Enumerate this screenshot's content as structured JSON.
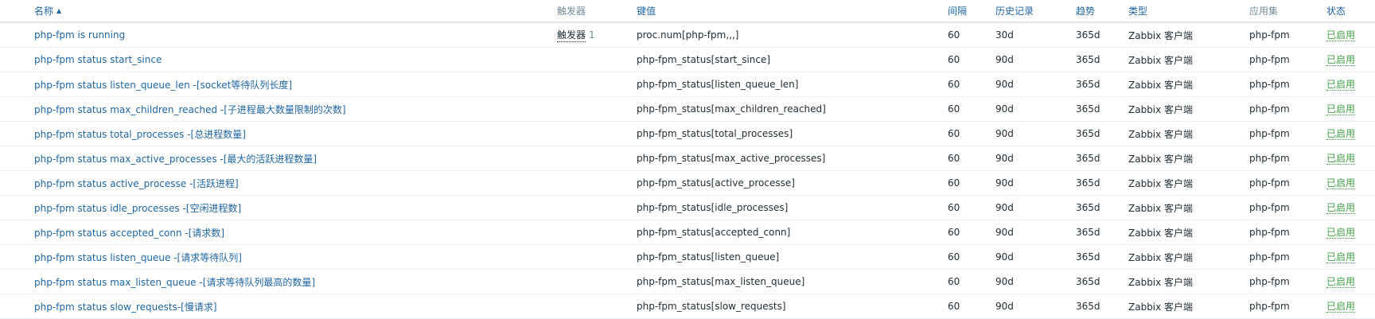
{
  "header": {
    "name": "名称",
    "sort_indicator": "▲",
    "triggers": "触发器",
    "key": "键值",
    "interval": "间隔",
    "history": "历史记录",
    "trends": "趋势",
    "type": "类型",
    "applications": "应用集",
    "status": "状态"
  },
  "colors": {
    "link": "#1f65a0",
    "muted_header": "#768d99",
    "enabled": "#429e47",
    "row_border": "#ebeef0"
  },
  "items": [
    {
      "name": "php-fpm is running",
      "trigger_label": "触发器",
      "trigger_count": "1",
      "key": "proc.num[php-fpm,,,]",
      "interval": "60",
      "history": "30d",
      "trends": "365d",
      "type": "Zabbix 客户端",
      "application": "php-fpm",
      "status": "已启用"
    },
    {
      "name": "php-fpm status start_since",
      "key": "php-fpm_status[start_since]",
      "interval": "60",
      "history": "90d",
      "trends": "365d",
      "type": "Zabbix 客户端",
      "application": "php-fpm",
      "status": "已启用"
    },
    {
      "name": "php-fpm status listen_queue_len -[socket等待队列长度]",
      "key": "php-fpm_status[listen_queue_len]",
      "interval": "60",
      "history": "90d",
      "trends": "365d",
      "type": "Zabbix 客户端",
      "application": "php-fpm",
      "status": "已启用"
    },
    {
      "name": "php-fpm status max_children_reached -[子进程最大数量限制的次数]",
      "key": "php-fpm_status[max_children_reached]",
      "interval": "60",
      "history": "90d",
      "trends": "365d",
      "type": "Zabbix 客户端",
      "application": "php-fpm",
      "status": "已启用"
    },
    {
      "name": "php-fpm status total_processes -[总进程数量]",
      "key": "php-fpm_status[total_processes]",
      "interval": "60",
      "history": "90d",
      "trends": "365d",
      "type": "Zabbix 客户端",
      "application": "php-fpm",
      "status": "已启用"
    },
    {
      "name": "php-fpm status max_active_processes -[最大的活跃进程数量]",
      "key": "php-fpm_status[max_active_processes]",
      "interval": "60",
      "history": "90d",
      "trends": "365d",
      "type": "Zabbix 客户端",
      "application": "php-fpm",
      "status": "已启用"
    },
    {
      "name": "php-fpm status active_processe -[活跃进程]",
      "key": "php-fpm_status[active_processe]",
      "interval": "60",
      "history": "90d",
      "trends": "365d",
      "type": "Zabbix 客户端",
      "application": "php-fpm",
      "status": "已启用"
    },
    {
      "name": "php-fpm status idle_processes -[空闲进程数]",
      "key": "php-fpm_status[idle_processes]",
      "interval": "60",
      "history": "90d",
      "trends": "365d",
      "type": "Zabbix 客户端",
      "application": "php-fpm",
      "status": "已启用"
    },
    {
      "name": "php-fpm status accepted_conn -[请求数]",
      "key": "php-fpm_status[accepted_conn]",
      "interval": "60",
      "history": "90d",
      "trends": "365d",
      "type": "Zabbix 客户端",
      "application": "php-fpm",
      "status": "已启用"
    },
    {
      "name": "php-fpm status listen_queue -[请求等待队列]",
      "key": "php-fpm_status[listen_queue]",
      "interval": "60",
      "history": "90d",
      "trends": "365d",
      "type": "Zabbix 客户端",
      "application": "php-fpm",
      "status": "已启用"
    },
    {
      "name": "php-fpm status max_listen_queue -[请求等待队列最高的数量]",
      "key": "php-fpm_status[max_listen_queue]",
      "interval": "60",
      "history": "90d",
      "trends": "365d",
      "type": "Zabbix 客户端",
      "application": "php-fpm",
      "status": "已启用"
    },
    {
      "name": "php-fpm status slow_requests-[慢请求]",
      "key": "php-fpm_status[slow_requests]",
      "interval": "60",
      "history": "90d",
      "trends": "365d",
      "type": "Zabbix 客户端",
      "application": "php-fpm",
      "status": "已启用"
    }
  ]
}
